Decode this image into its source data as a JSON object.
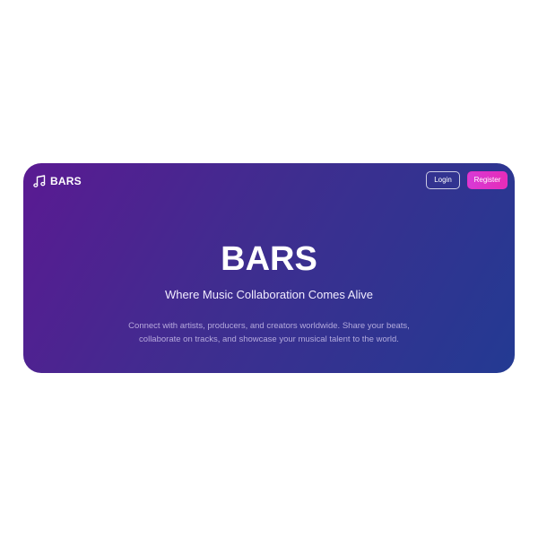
{
  "brand": {
    "icon": "music-note-icon",
    "name": "BARS"
  },
  "nav": {
    "login_label": "Login",
    "register_label": "Register"
  },
  "hero": {
    "title": "BARS",
    "subtitle": "Where Music Collaboration Comes Alive",
    "description": "Connect with artists, producers, and creators worldwide. Share your beats, collaborate on tracks, and showcase your musical talent to the world."
  },
  "colors": {
    "gradient_start": "#5a1a92",
    "gradient_end": "#233a92",
    "register_accent": "#e62cb8",
    "text": "#ffffff"
  }
}
